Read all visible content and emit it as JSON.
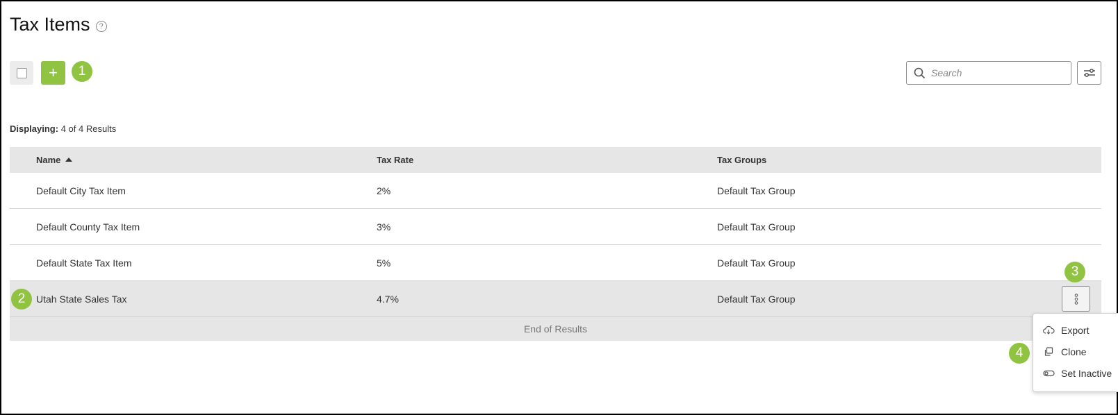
{
  "page": {
    "title": "Tax Items",
    "help_icon": "question-circle-icon"
  },
  "toolbar": {
    "add_label": "+",
    "search_placeholder": "Search",
    "search_icon": "search-icon",
    "filter_icon": "filter-sliders-icon"
  },
  "results": {
    "label": "Displaying:",
    "summary": "4 of 4 Results"
  },
  "table": {
    "headers": {
      "name": "Name",
      "tax_rate": "Tax Rate",
      "tax_groups": "Tax Groups"
    },
    "sort_column": "Name",
    "rows": [
      {
        "name": "Default City Tax Item",
        "tax_rate": "2%",
        "tax_groups": "Default Tax Group"
      },
      {
        "name": "Default County Tax Item",
        "tax_rate": "3%",
        "tax_groups": "Default Tax Group"
      },
      {
        "name": "Default State Tax Item",
        "tax_rate": "5%",
        "tax_groups": "Default Tax Group"
      },
      {
        "name": "Utah State Sales Tax",
        "tax_rate": "4.7%",
        "tax_groups": "Default Tax Group"
      }
    ],
    "end_label": "End of Results"
  },
  "row_menu": {
    "items": [
      {
        "label": "Export",
        "icon": "cloud-download-icon"
      },
      {
        "label": "Clone",
        "icon": "clone-icon"
      },
      {
        "label": "Set Inactive",
        "icon": "toggle-icon"
      }
    ]
  },
  "callouts": [
    "1",
    "2",
    "3",
    "4"
  ],
  "colors": {
    "accent": "#8fc341",
    "header_bg": "#e6e6e6"
  }
}
